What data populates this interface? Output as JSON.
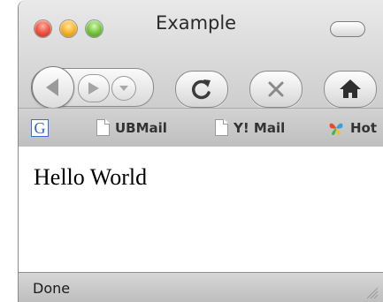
{
  "window": {
    "title": "Example"
  },
  "toolbar": {
    "back_icon": "back-arrow-icon",
    "forward_icon": "forward-arrow-icon",
    "history_icon": "chevron-down-icon",
    "reload_icon": "reload-icon",
    "stop_icon": "stop-icon",
    "home_icon": "home-icon"
  },
  "bookmarks": {
    "google_glyph": "G",
    "items": [
      {
        "label": "UBMail",
        "icon": "document-icon"
      },
      {
        "label": "Y! Mail",
        "icon": "document-icon"
      },
      {
        "label": "Hot",
        "icon": "butterfly-icon"
      }
    ]
  },
  "content": {
    "text": "Hello World"
  },
  "status": {
    "text": "Done"
  },
  "colors": {
    "close": "#ef5b4a",
    "minimize": "#f7b733",
    "zoom": "#7cc947",
    "google_blue": "#2f62d6"
  }
}
